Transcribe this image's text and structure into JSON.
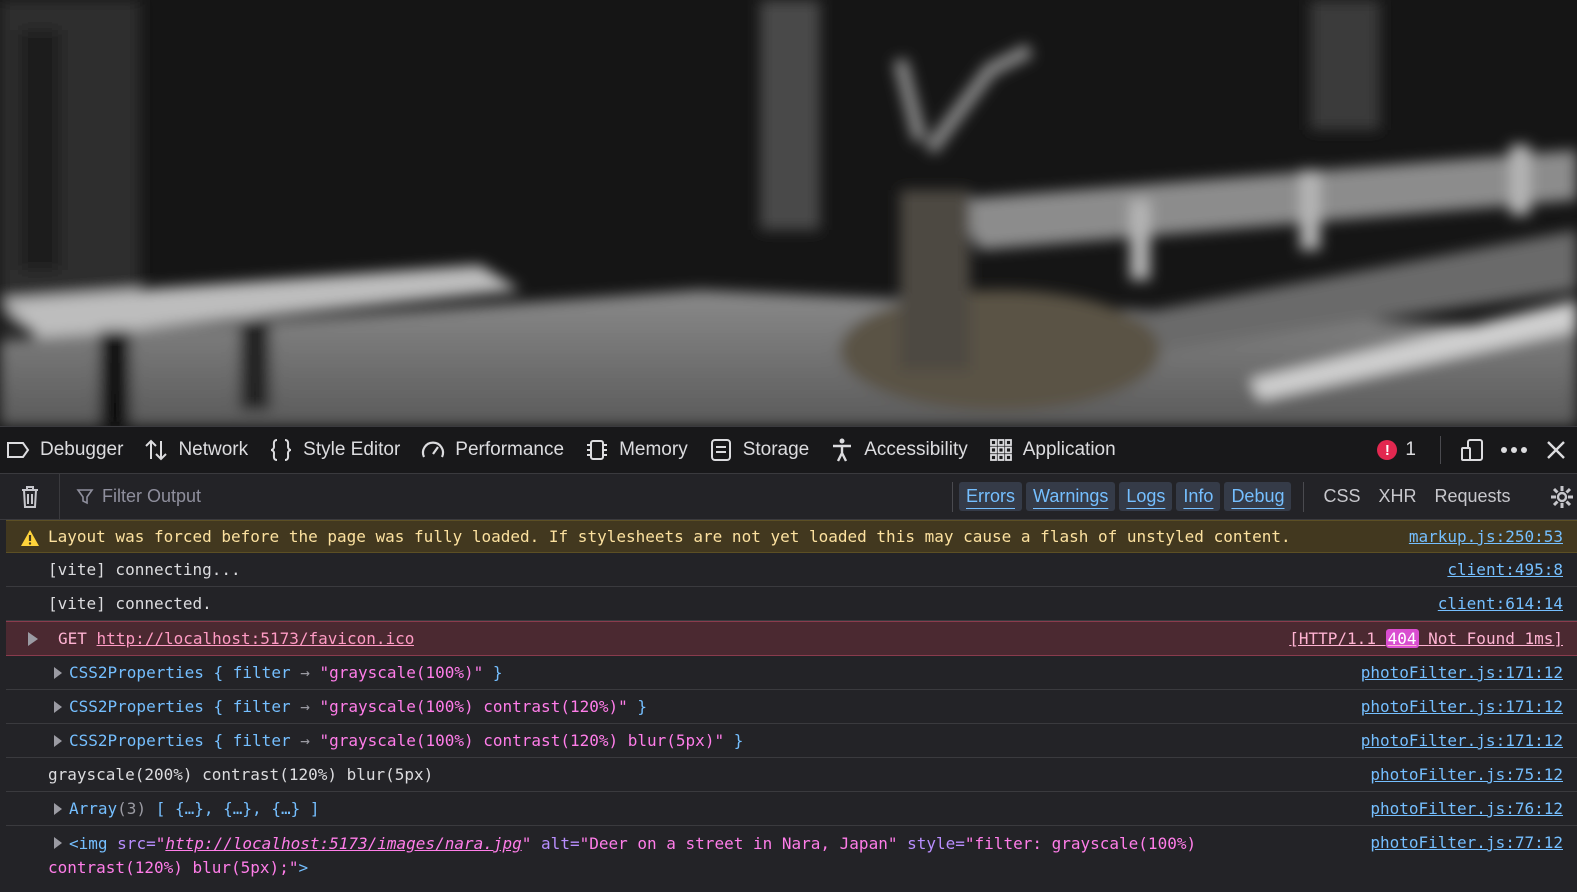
{
  "tabs": [
    {
      "label": "Debugger",
      "icon": "debugger-icon"
    },
    {
      "label": "Network",
      "icon": "network-icon"
    },
    {
      "label": "Style Editor",
      "icon": "style-editor-icon"
    },
    {
      "label": "Performance",
      "icon": "performance-icon"
    },
    {
      "label": "Memory",
      "icon": "memory-icon"
    },
    {
      "label": "Storage",
      "icon": "storage-icon"
    },
    {
      "label": "Accessibility",
      "icon": "accessibility-icon"
    },
    {
      "label": "Application",
      "icon": "application-icon"
    }
  ],
  "toolbar_right": {
    "error_count": "1",
    "error_icon": "!"
  },
  "filter": {
    "placeholder": "Filter Output",
    "levels": [
      "Errors",
      "Warnings",
      "Logs",
      "Info",
      "Debug"
    ],
    "categories": [
      "CSS",
      "XHR",
      "Requests"
    ]
  },
  "console": {
    "warning": {
      "text": "Layout was forced before the page was fully loaded. If stylesheets are not yet loaded this may cause a flash of unstyled content.",
      "source": "markup.js:250:53"
    },
    "vite_connecting": {
      "text": "[vite] connecting...",
      "source": "client:495:8"
    },
    "vite_connected": {
      "text": "[vite] connected.",
      "source": "client:614:14"
    },
    "network_error": {
      "method": "GET",
      "url": "http://localhost:5173/favicon.ico",
      "status_prefix": "[HTTP/1.1",
      "status_code": "404",
      "status_suffix": "Not Found 1ms]"
    },
    "css_rows": [
      {
        "obj": "CSS2Properties",
        "open": "{",
        "key": "filter",
        "arrow": "→",
        "value": "\"grayscale(100%)\"",
        "close": "}",
        "source": "photoFilter.js:171:12"
      },
      {
        "obj": "CSS2Properties",
        "open": "{",
        "key": "filter",
        "arrow": "→",
        "value": "\"grayscale(100%) contrast(120%)\"",
        "close": "}",
        "source": "photoFilter.js:171:12"
      },
      {
        "obj": "CSS2Properties",
        "open": "{",
        "key": "filter",
        "arrow": "→",
        "value": "\"grayscale(100%) contrast(120%) blur(5px)\"",
        "close": "}",
        "source": "photoFilter.js:171:12"
      }
    ],
    "plain_log": {
      "text": "grayscale(200%) contrast(120%) blur(5px)",
      "source": "photoFilter.js:75:12"
    },
    "array_log": {
      "name": "Array",
      "count": "(3)",
      "items": "[ {…}, {…}, {…} ]",
      "source": "photoFilter.js:76:12"
    },
    "img_log": {
      "open": "<img",
      "src_attr": "src=",
      "src_val": "http://localhost:5173/images/nara.jpg",
      "alt_attr": "alt=",
      "alt_val": "\"Deer on a street in Nara, Japan\"",
      "style_attr": "style=",
      "style_val_1": "\"filter: grayscale(100%)",
      "style_val_2": "contrast(120%) blur(5px);\"",
      "close": ">",
      "source": "photoFilter.js:77:12"
    }
  }
}
